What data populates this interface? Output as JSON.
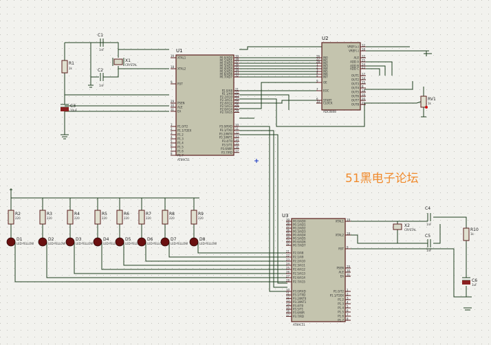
{
  "watermark": "51黑电子论坛",
  "u1": {
    "ref": "U1",
    "part": "AT89C51",
    "left_pins": [
      {
        "no": "19",
        "name": "XTAL1"
      },
      {
        "no": "18",
        "name": "XTAL2"
      },
      {
        "no": "9",
        "name": "RST"
      },
      {
        "no": "29",
        "name": "PSEN"
      },
      {
        "no": "30",
        "name": "ALE"
      },
      {
        "no": "31",
        "name": "EA"
      },
      {
        "no": "1",
        "name": "P1.0/T2"
      },
      {
        "no": "2",
        "name": "P1.1/T2EX"
      },
      {
        "no": "3",
        "name": "P1.2"
      },
      {
        "no": "4",
        "name": "P1.3"
      },
      {
        "no": "5",
        "name": "P1.4"
      },
      {
        "no": "6",
        "name": "P1.5"
      },
      {
        "no": "7",
        "name": "P1.6"
      },
      {
        "no": "8",
        "name": "P1.7"
      }
    ],
    "right_pins": [
      {
        "no": "39",
        "name": "P0.0/AD0"
      },
      {
        "no": "38",
        "name": "P0.1/AD1"
      },
      {
        "no": "37",
        "name": "P0.2/AD2"
      },
      {
        "no": "36",
        "name": "P0.3/AD3"
      },
      {
        "no": "35",
        "name": "P0.4/AD4"
      },
      {
        "no": "34",
        "name": "P0.5/AD5"
      },
      {
        "no": "33",
        "name": "P0.6/AD6"
      },
      {
        "no": "32",
        "name": "P0.7/AD7"
      },
      {
        "no": "21",
        "name": "P2.0/A8"
      },
      {
        "no": "22",
        "name": "P2.1/A9"
      },
      {
        "no": "23",
        "name": "P2.2/A10"
      },
      {
        "no": "24",
        "name": "P2.3/A11"
      },
      {
        "no": "25",
        "name": "P2.4/A12"
      },
      {
        "no": "26",
        "name": "P2.5/A13"
      },
      {
        "no": "27",
        "name": "P2.6/A14"
      },
      {
        "no": "28",
        "name": "P2.7/A15"
      },
      {
        "no": "10",
        "name": "P3.0/RXD"
      },
      {
        "no": "11",
        "name": "P3.1/TXD"
      },
      {
        "no": "12",
        "name": "P3.2/INT0"
      },
      {
        "no": "13",
        "name": "P3.3/INT1"
      },
      {
        "no": "14",
        "name": "P3.4/T0"
      },
      {
        "no": "15",
        "name": "P3.5/T1"
      },
      {
        "no": "16",
        "name": "P3.6/WR"
      },
      {
        "no": "17",
        "name": "P3.7/RD"
      }
    ]
  },
  "u2": {
    "ref": "U2",
    "part": "ADC0808",
    "left_pins": [
      {
        "no": "26",
        "name": "IN0"
      },
      {
        "no": "27",
        "name": "IN1"
      },
      {
        "no": "28",
        "name": "IN2"
      },
      {
        "no": "1",
        "name": "IN3"
      },
      {
        "no": "2",
        "name": "IN4"
      },
      {
        "no": "3",
        "name": "IN5"
      },
      {
        "no": "4",
        "name": "IN6"
      },
      {
        "no": "5",
        "name": "IN7"
      },
      {
        "no": "9",
        "name": "OE"
      },
      {
        "no": "7",
        "name": "EOC"
      },
      {
        "no": "6",
        "name": "START"
      },
      {
        "no": "10",
        "name": "CLOCK"
      }
    ],
    "right_pins": [
      {
        "no": "12",
        "name": "VREF(+)"
      },
      {
        "no": "16",
        "name": "VREF(-)"
      },
      {
        "no": "22",
        "name": "ALE"
      },
      {
        "no": "25",
        "name": "ADD A"
      },
      {
        "no": "24",
        "name": "ADD B"
      },
      {
        "no": "23",
        "name": "ADD C"
      },
      {
        "no": "17",
        "name": "OUT1"
      },
      {
        "no": "14",
        "name": "OUT2"
      },
      {
        "no": "15",
        "name": "OUT3"
      },
      {
        "no": "8",
        "name": "OUT4"
      },
      {
        "no": "18",
        "name": "OUT5"
      },
      {
        "no": "19",
        "name": "OUT6"
      },
      {
        "no": "20",
        "name": "OUT7"
      },
      {
        "no": "21",
        "name": "OUT8"
      }
    ]
  },
  "u3": {
    "ref": "U3",
    "part": "AT89C51",
    "left_pins": [
      {
        "no": "39",
        "name": "P0.0/AD0"
      },
      {
        "no": "38",
        "name": "P0.1/AD1"
      },
      {
        "no": "37",
        "name": "P0.2/AD2"
      },
      {
        "no": "36",
        "name": "P0.3/AD3"
      },
      {
        "no": "35",
        "name": "P0.4/AD4"
      },
      {
        "no": "34",
        "name": "P0.5/AD5"
      },
      {
        "no": "33",
        "name": "P0.6/AD6"
      },
      {
        "no": "32",
        "name": "P0.7/AD7"
      },
      {
        "no": "21",
        "name": "P2.0/A8"
      },
      {
        "no": "22",
        "name": "P2.1/A9"
      },
      {
        "no": "23",
        "name": "P2.2/A10"
      },
      {
        "no": "24",
        "name": "P2.3/A11"
      },
      {
        "no": "25",
        "name": "P2.4/A12"
      },
      {
        "no": "26",
        "name": "P2.5/A13"
      },
      {
        "no": "27",
        "name": "P2.6/A14"
      },
      {
        "no": "28",
        "name": "P2.7/A15"
      },
      {
        "no": "10",
        "name": "P3.0/RXD"
      },
      {
        "no": "11",
        "name": "P3.1/TXD"
      },
      {
        "no": "12",
        "name": "P3.2/INT0"
      },
      {
        "no": "13",
        "name": "P3.3/INT1"
      },
      {
        "no": "14",
        "name": "P3.4/T0"
      },
      {
        "no": "15",
        "name": "P3.5/T1"
      },
      {
        "no": "16",
        "name": "P3.6/WR"
      },
      {
        "no": "17",
        "name": "P3.7/RD"
      }
    ],
    "right_pins": [
      {
        "no": "19",
        "name": "XTAL1"
      },
      {
        "no": "18",
        "name": "XTAL2"
      },
      {
        "no": "9",
        "name": "RST"
      },
      {
        "no": "29",
        "name": "PSEN"
      },
      {
        "no": "30",
        "name": "ALE"
      },
      {
        "no": "31",
        "name": "EA"
      },
      {
        "no": "1",
        "name": "P1.0/T2"
      },
      {
        "no": "2",
        "name": "P1.1/T2EX"
      },
      {
        "no": "3",
        "name": "P1.2"
      },
      {
        "no": "4",
        "name": "P1.3"
      },
      {
        "no": "5",
        "name": "P1.4"
      },
      {
        "no": "6",
        "name": "P1.5"
      },
      {
        "no": "7",
        "name": "P1.6"
      },
      {
        "no": "8",
        "name": "P1.7"
      }
    ]
  },
  "parts": {
    "c1": {
      "ref": "C1",
      "value": "1nF"
    },
    "c2": {
      "ref": "C2",
      "value": "1nF"
    },
    "c3": {
      "ref": "C3",
      "value": "10uF"
    },
    "c4": {
      "ref": "C4",
      "value": "1nF"
    },
    "c5": {
      "ref": "C5",
      "value": "1nF"
    },
    "c6": {
      "ref": "C6",
      "value": "1uF"
    },
    "x1": {
      "ref": "X1",
      "value": "CRYSTAL"
    },
    "x2": {
      "ref": "X2",
      "value": "CRYSTAL"
    },
    "r1": {
      "ref": "R1",
      "value": "1k"
    },
    "r10": {
      "ref": "R10",
      "value": "1k"
    },
    "rv1": {
      "ref": "RV1",
      "value": "1k"
    }
  },
  "resistors": [
    {
      "ref": "R2",
      "value": "220"
    },
    {
      "ref": "R3",
      "value": "220"
    },
    {
      "ref": "R4",
      "value": "220"
    },
    {
      "ref": "R5",
      "value": "220"
    },
    {
      "ref": "R6",
      "value": "220"
    },
    {
      "ref": "R7",
      "value": "220"
    },
    {
      "ref": "R8",
      "value": "220"
    },
    {
      "ref": "R9",
      "value": "220"
    }
  ],
  "leds": [
    {
      "ref": "D1",
      "part": "LED-YELLOW"
    },
    {
      "ref": "D2",
      "part": "LED-YELLOW"
    },
    {
      "ref": "D3",
      "part": "LED-YELLOW"
    },
    {
      "ref": "D4",
      "part": "LED-YELLOW"
    },
    {
      "ref": "D5",
      "part": "LED-YELLOW"
    },
    {
      "ref": "D6",
      "part": "LED-YELLOW"
    },
    {
      "ref": "D7",
      "part": "LED-YELLOW"
    },
    {
      "ref": "D8",
      "part": "LED-YELLOW"
    }
  ],
  "colors": {
    "chip_fill": "#c4c4ae",
    "chip_border": "#5a1d1d",
    "wire": "#1d3d1d",
    "led": "#6a1010",
    "watermark": "#f08a2c",
    "probe": "#d01010"
  }
}
